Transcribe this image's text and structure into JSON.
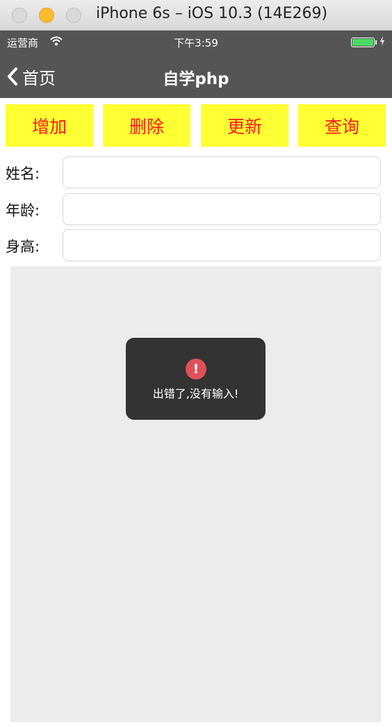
{
  "window": {
    "title": "iPhone 6s – iOS 10.3 (14E269)"
  },
  "status_bar": {
    "carrier": "运营商",
    "time": "下午3:59",
    "battery_level": 1.0
  },
  "nav": {
    "back_label": "首页",
    "title": "自学php"
  },
  "actions": [
    "增加",
    "删除",
    "更新",
    "查询"
  ],
  "form": {
    "fields": [
      {
        "label": "姓名:",
        "value": "",
        "placeholder": ""
      },
      {
        "label": "年龄:",
        "value": "",
        "placeholder": ""
      },
      {
        "label": "身高:",
        "value": "",
        "placeholder": ""
      }
    ]
  },
  "toast": {
    "icon": "error-icon",
    "icon_glyph": "!",
    "message": "出错了,没有输入!"
  },
  "colors": {
    "nav_background": "#555555",
    "button_background": "#ffff33",
    "button_text": "#ff1a1a",
    "toast_background": "#333333",
    "toast_icon": "#e0505a",
    "content_background": "#ececec"
  }
}
